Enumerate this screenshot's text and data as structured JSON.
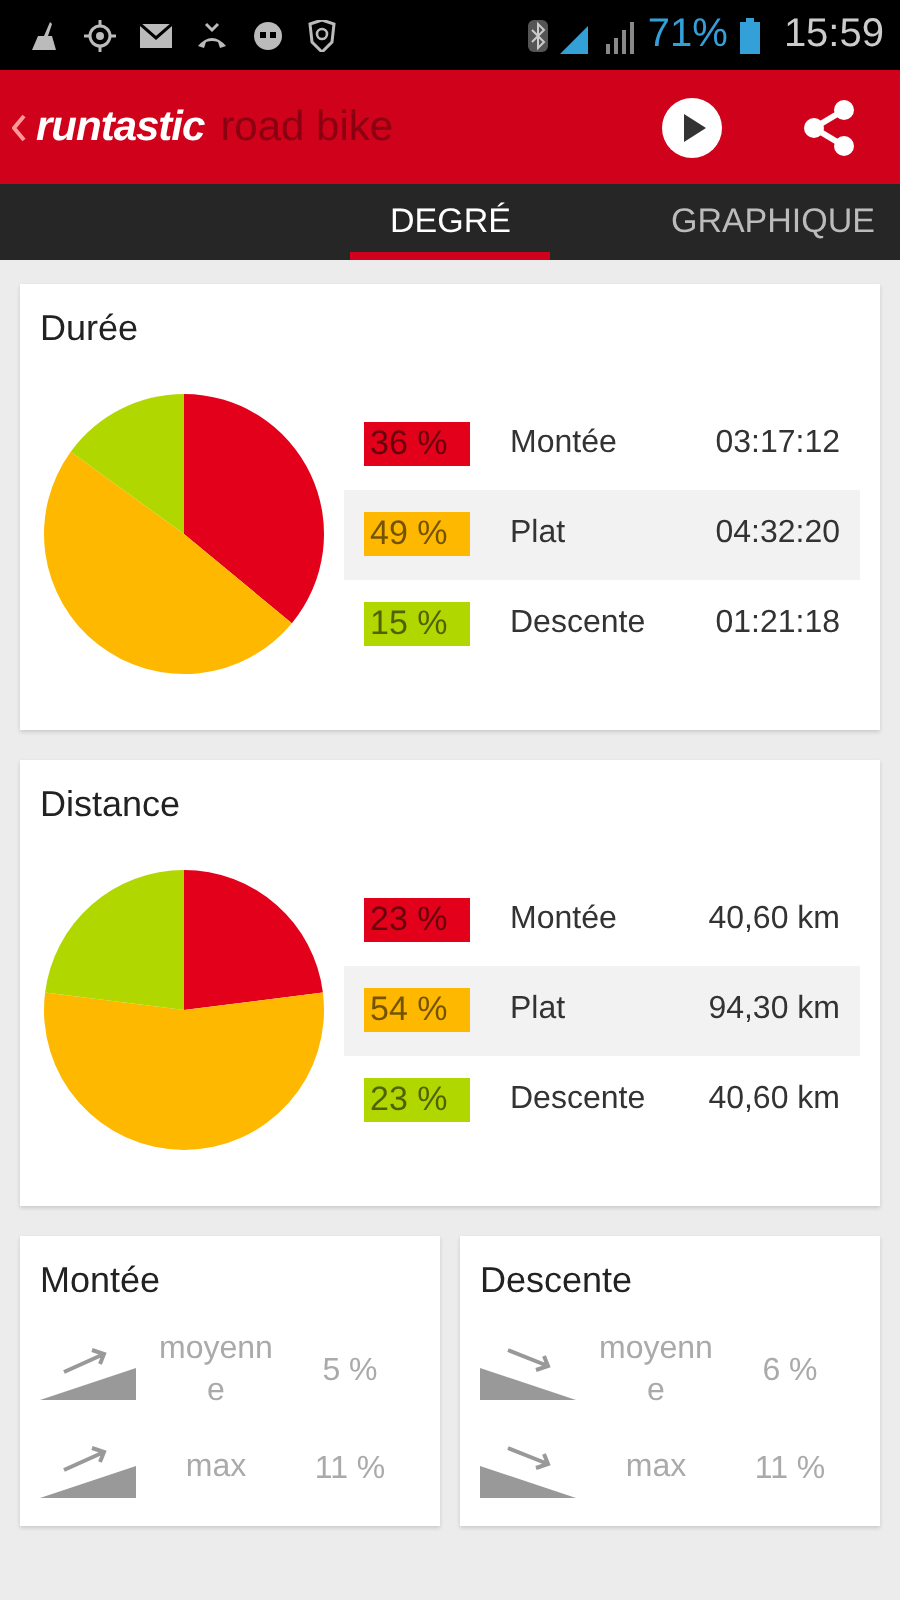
{
  "status_bar": {
    "battery_text": "71%",
    "time": "15:59"
  },
  "app_bar": {
    "logo": "runtastic",
    "product": "road bike"
  },
  "tabs": [
    {
      "label": "DEGRÉ",
      "selected": true
    },
    {
      "label": "GRAPHIQUE",
      "selected": false
    }
  ],
  "cards": [
    {
      "title": "Durée",
      "chart_data": {
        "type": "pie",
        "categories": [
          "Montée",
          "Plat",
          "Descente"
        ],
        "values": [
          36,
          49,
          15
        ]
      },
      "rows": [
        {
          "percent": "36 %",
          "value": "03:17:12",
          "color": "#e2001a",
          "selected": false
        },
        {
          "percent": "49 %",
          "value": "04:32:20",
          "color": "#ffb800",
          "selected": true
        },
        {
          "percent": "15 %",
          "value": "01:21:18",
          "color": "#b0d800",
          "selected": false
        }
      ]
    },
    {
      "title": "Distance",
      "chart_data": {
        "type": "pie",
        "categories": [
          "Montée",
          "Plat",
          "Descente"
        ],
        "values": [
          23,
          54,
          23
        ]
      },
      "rows": [
        {
          "percent": "23 %",
          "value": "40,60 km",
          "color": "#e2001a",
          "selected": false
        },
        {
          "percent": "54 %",
          "value": "94,30 km",
          "color": "#ffb800",
          "selected": true
        },
        {
          "percent": "23 %",
          "value": "40,60 km",
          "color": "#b0d800",
          "selected": false
        }
      ]
    }
  ],
  "slope_cards": [
    {
      "title": "Montée",
      "kind": "up",
      "stats": [
        {
          "label": "moyenne",
          "value": "5 %"
        },
        {
          "label": "max",
          "value": "11 %"
        }
      ]
    },
    {
      "title": "Descente",
      "kind": "down",
      "stats": [
        {
          "label": "moyenne",
          "value": "6 %"
        },
        {
          "label": "max",
          "value": "11 %"
        }
      ]
    }
  ]
}
